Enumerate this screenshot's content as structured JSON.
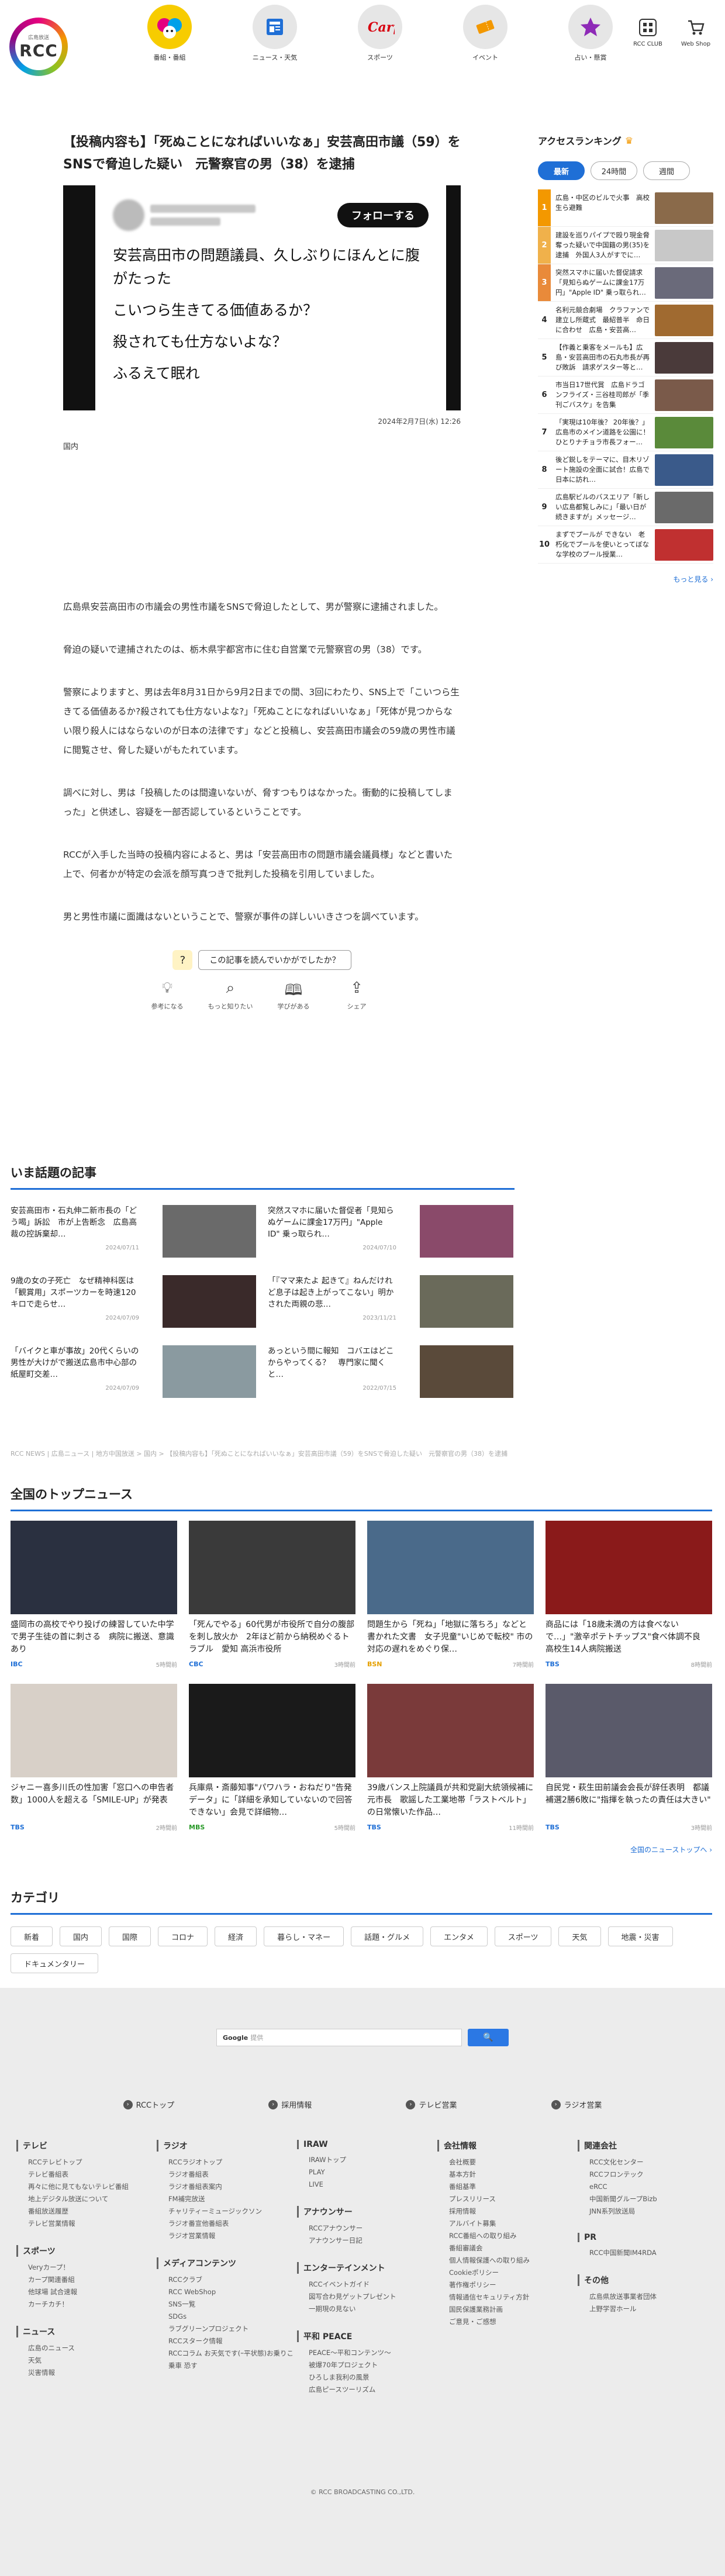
{
  "header": {
    "logo_small": "広島放送",
    "logo_text": "RCC",
    "nav": [
      {
        "label": "番組・番組",
        "icon": "character-icon",
        "color": "#f7cc00"
      },
      {
        "label": "ニュース・天気",
        "icon": "news-icon",
        "color": "#e6e6e6"
      },
      {
        "label": "スポーツ",
        "icon": "carp-icon",
        "color": "#e6e6e6"
      },
      {
        "label": "イベント",
        "icon": "ticket-icon",
        "color": "#e6e6e6"
      },
      {
        "label": "占い・懸賞",
        "icon": "star-icon",
        "color": "#e6e6e6"
      }
    ],
    "right": [
      {
        "label": "RCC CLUB",
        "icon": "grid-icon"
      },
      {
        "label": "Web Shop",
        "icon": "cart-icon"
      }
    ]
  },
  "article": {
    "title": "【投稿内容も】「死ぬことになればいいなぁ」安芸高田市議（59）をSNSで脅迫した疑い　元警察官の男（38）を逮捕",
    "tweet": {
      "follow": "フォローする",
      "lines": [
        "安芸高田市の問題議員、久しぶりにほんとに腹がたった",
        "こいつら生きてる価値あるか？",
        "殺されても仕方ないよな？",
        "ふるえて眠れ"
      ]
    },
    "date": "2024年2月7日(水) 12:26",
    "category": "国内",
    "paragraphs": [
      "広島県安芸高田市の市議会の男性市議をSNSで脅迫したとして、男が警察に逮捕されました。",
      "脅迫の疑いで逮捕されたのは、栃木県宇都宮市に住む自営業で元警察官の男（38）です。",
      "警察によりますと、男は去年8月31日から9月2日までの間、3回にわたり、SNS上で「こいつら生きてる価値あるか?殺されても仕方ないよな?」「死ぬことになればいいなぁ」「死体が見つからない限り殺人にはならないのが日本の法律です」などと投稿し、安芸高田市議会の59歳の男性市議に閲覧させ、脅した疑いがもたれています。",
      "調べに対し、男は「投稿したのは間違いないが、脅すつもりはなかった。衝動的に投稿してしまった」と供述し、容疑を一部否認しているということです。",
      "RCCが入手した当時の投稿内容によると、男は「安芸高田市の問題市議会議員様」などと書いた上で、何者かが特定の会派を顔写真つきで批判した投稿を引用していました。",
      "男と男性市議に面識はないということで、警察が事件の詳しいいきさつを調べています。"
    ],
    "feedback": {
      "question": "この記事を読んでいかがでしたか？",
      "options": [
        {
          "label": "参考になる",
          "icon": "lightbulb-icon"
        },
        {
          "label": "もっと知りたい",
          "icon": "magnifier-icon"
        },
        {
          "label": "学びがある",
          "icon": "book-icon"
        },
        {
          "label": "シェア",
          "icon": "share-icon"
        }
      ]
    }
  },
  "ranking": {
    "title": "アクセスランキング",
    "tabs": [
      "最新",
      "24時間",
      "週間"
    ],
    "items": [
      {
        "text": "広島・中区のビルで火事　高校生ら避難",
        "color": "#8a6a4a"
      },
      {
        "text": "建設を巡りパイプで殴り現金脅奪った疑いで中国籍の男(35)を逮捕　外国人3人がすでに…",
        "color": "#c8c8c8"
      },
      {
        "text": "突然スマホに届いた督促請求「見知らぬゲームに課金17万円」\"Apple ID\" 乗っ取られ…",
        "color": "#6a6a7a"
      },
      {
        "text": "名利元競合劇場　クラファンで建立し所蔵式　最紹普半　命日に合わせ　広島・安芸高…",
        "color": "#a06a30"
      },
      {
        "text": "【作義と乗客をメールも】広島・安芸高田市の石丸市長が再び敗訴　請求ゲスター等と…",
        "color": "#4a3a3a"
      },
      {
        "text": "市当日17世代賞　広島ドラゴンフライズ・三谷桂司郎が「季刊ごバスケ」を告集",
        "color": "#7a5a4a"
      },
      {
        "text": "「実現は10年後？ 20年後？」広島市のメイン道路を公園に！ ひとりナチョラ市長フォー…",
        "color": "#5a8a3a"
      },
      {
        "text": "後ど鋭しをテーマに、目木リゾート施設の全面に試合！広島で日本に訪れ…",
        "color": "#3a5a8a"
      },
      {
        "text": "広島駅ビルのバスエリア「新しい広島都覧しみに」「最い日が続きますが」メッセージ…",
        "color": "#6a6a6a"
      },
      {
        "text": "まずでプールが できない　老朽化でプールを使いとってぼなな学校のプール授業…",
        "color": "#c03030"
      }
    ],
    "more": "もっと見る"
  },
  "hot_topics": {
    "title": "いま話題の記事",
    "items": [
      {
        "title": "安芸高田市・石丸伸二新市長の「どう喝」訴訟　市が上告断念　広島高裁の控訴棄却…",
        "date": "2024/07/11",
        "color": "#6a6a6a"
      },
      {
        "title": "突然スマホに届いた督促者「見知らぬゲームに課金17万円」\"Apple ID\" 乗っ取られ…",
        "date": "2024/07/10",
        "color": "#8a4a6a"
      },
      {
        "title": "9歳の女の子死亡　なぜ精神科医は「観賞用」スポーツカーを時速120キロで走らせ…",
        "date": "2024/07/09",
        "color": "#3a2a2a"
      },
      {
        "title": "「『ママ来たよ 起きて』ねんだけれど息子は起き上がってこない」明かされた両親の悲…",
        "date": "2023/11/21",
        "color": "#6a6a5a"
      },
      {
        "title": "「バイクと車が事故」20代くらいの男性が大けがで搬送広島市中心部の紙屋町交差…",
        "date": "2024/07/09",
        "color": "#8a9aa0"
      },
      {
        "title": "あっという間に報知　コバエはどこからやってくる？　専門家に聞くと…",
        "date": "2022/07/15",
        "color": "#5a4a3a"
      }
    ]
  },
  "breadcrumb": "RCC NEWS | 広島ニュース | 地方中国放送 > 国内 > 【投稿内容も】「死ぬことになればいいなぁ」安芸高田市議（59）をSNSで脅迫した疑い　元警察官の男（38）を逮捕",
  "top_news": {
    "title": "全国のトップニュース",
    "items": [
      {
        "title": "盛岡市の高校でやり投げの練習していた中学で男子生徒の首に刺さる　病院に搬送、意識あり",
        "source": "IBC",
        "time": "5時間前",
        "color": "#2a3040",
        "src_color": "#1f6fd6"
      },
      {
        "title": "「死んでやる」60代男が市役所で自分の腹部を刺し放火か　2年ほど前から納税めぐるトラブル　愛知 高浜市役所",
        "source": "CBC",
        "time": "3時間前",
        "color": "#3a3a3a",
        "src_color": "#1f6fd6"
      },
      {
        "title": "問題生から「死ね」「地獄に落ちろ」などと書かれた文書　女子児童\"いじめで転校\" 市の対応の遅れをめぐり保…",
        "source": "BSN",
        "time": "7時間前",
        "color": "#4a6a8a",
        "src_color": "#e5a000"
      },
      {
        "title": "商品には「18歳未満の方は食べないで…」\"激辛ポテトチップス\"食べ体調不良　高校生14人病院搬送",
        "source": "TBS",
        "time": "8時間前",
        "color": "#8a1a1a",
        "src_color": "#1f6fd6"
      },
      {
        "title": "ジャニー喜多川氏の性加害「窓口への申告者数」1000人を超える「SMILE-UP」が発表",
        "source": "TBS",
        "time": "2時間前",
        "color": "#d8d0c8",
        "src_color": "#1f6fd6"
      },
      {
        "title": "兵庫県・斎藤知事\"パワハラ・おねだり\"告発データ」に「詳細を承知していないので回答できない」会見で詳細物…",
        "source": "MBS",
        "time": "5時間前",
        "color": "#1a1a1a",
        "src_color": "#2a9a2a"
      },
      {
        "title": "39歳バンス上院議員が共和党副大統領候補に　元市長　歌謡した工業地帯「ラストベルト」の日常懐いた作品…",
        "source": "TBS",
        "time": "11時間前",
        "color": "#7a3a3a",
        "src_color": "#1f6fd6"
      },
      {
        "title": "自民党・萩生田前議会会長が辞任表明　都議補選2勝6敗に\"指揮を執ったの責任は大きい\"",
        "source": "TBS",
        "time": "3時間前",
        "color": "#5a5a6a",
        "src_color": "#1f6fd6"
      }
    ],
    "more": "全国のニューストップへ"
  },
  "categories": {
    "title": "カテゴリ",
    "items": [
      "新着",
      "国内",
      "国際",
      "コロナ",
      "経済",
      "暮らし・マネー",
      "話題・グルメ",
      "エンタメ",
      "スポーツ",
      "天気",
      "地震・災害",
      "ドキュメンタリー"
    ]
  },
  "footer": {
    "search_brand": "Google",
    "search_placeholder": "提供",
    "search_btn": "🔍",
    "top_links": [
      "RCCトップ",
      "採用情報",
      "テレビ営業",
      "ラジオ営業"
    ],
    "columns": [
      [
        {
          "head": "テレビ",
          "links": [
            "RCCテレビトップ",
            "テレビ番組表",
            "再々に他に見てもないテレビ番組",
            "地上デジタル放送について",
            "番組放送履歴",
            "テレビ営業情報"
          ]
        },
        {
          "head": "スポーツ",
          "links": [
            "Veryカープ！",
            "カープ関連番組",
            "他球場 試合速報",
            "カーチカチ！"
          ]
        },
        {
          "head": "ニュース",
          "links": [
            "広島のニュース",
            "天気",
            "災害情報"
          ]
        }
      ],
      [
        {
          "head": "ラジオ",
          "links": [
            "RCCラジオトップ",
            "ラジオ番組表",
            "ラジオ番組表案内",
            "FM補完放送",
            "チャリティーミュージックソン",
            "ラジオ番宣他番組表",
            "ラジオ営業情報"
          ]
        },
        {
          "head": "メディアコンテンツ",
          "links": [
            "RCCクラブ",
            "RCC WebShop",
            "SNS一覧",
            "SDGs",
            "ラブグリーンプロジェクト",
            "RCCスターク情報",
            "RCCコラム お天気です(ｰ平状態)お乗りこ乗車 恐す"
          ]
        }
      ],
      [
        {
          "head": "IRAW",
          "links": [
            "IRAWトップ",
            "PLAY",
            "LIVE"
          ]
        },
        {
          "head": "アナウンサー",
          "links": [
            "RCCアナウンサー",
            "アナウンサー日記"
          ]
        },
        {
          "head": "エンターテインメント",
          "links": [
            "RCCイベントガイド",
            "図写合わ見ゲットプレゼント",
            "一期現の見ない"
          ]
        },
        {
          "head": "平和 PEACE",
          "links": [
            "PEACE～平和コンテンツ～",
            "被爆70年プロジェクト",
            "ひろしま我利の風景",
            "広島ピースツーリズム"
          ]
        }
      ],
      [
        {
          "head": "会社情報",
          "links": [
            "会社概要",
            "基本方針",
            "番組基準",
            "プレスリリース",
            "採用情報",
            "アルバイト募集",
            "RCC番組への取り組み",
            "番組審議会",
            "個人情報保護への取り組み",
            "Cookieポリシー",
            "著作権ポリシー",
            "情報通信セキュリティ方針",
            "国民保護業務計画",
            "ご意見・ご感想"
          ]
        }
      ],
      [
        {
          "head": "関連会社",
          "links": [
            "RCC文化センター",
            "RCCフロンテック",
            "eRCC",
            "中国新聞グループBizb",
            "JNN系列放送局"
          ]
        },
        {
          "head": "PR",
          "links": [
            "RCC中国新聞IM4RDA"
          ]
        },
        {
          "head": "その他",
          "links": [
            "広島県放送事業者団体",
            "上野学習ホール"
          ]
        }
      ]
    ],
    "copyright": "© RCC BROADCASTING CO.,LTD."
  }
}
